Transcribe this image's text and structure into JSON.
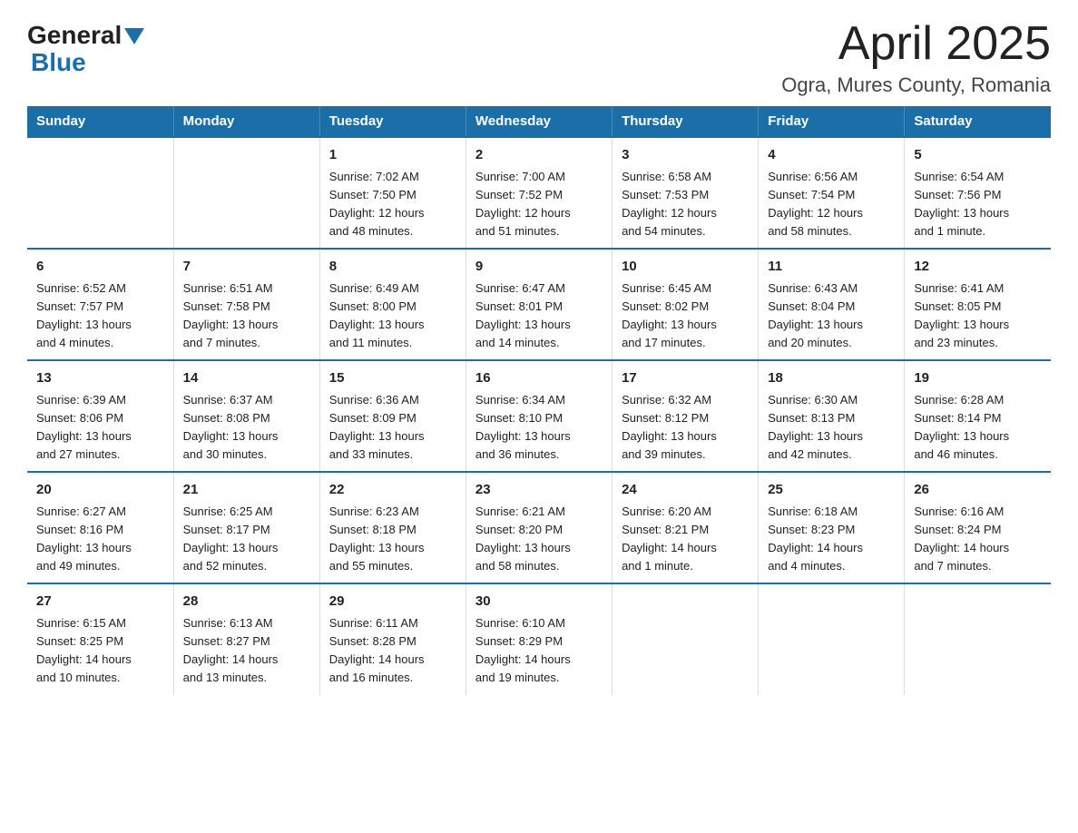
{
  "logo": {
    "general": "General",
    "blue": "Blue"
  },
  "header": {
    "month_year": "April 2025",
    "location": "Ogra, Mures County, Romania"
  },
  "days_of_week": [
    "Sunday",
    "Monday",
    "Tuesday",
    "Wednesday",
    "Thursday",
    "Friday",
    "Saturday"
  ],
  "weeks": [
    [
      {
        "day": "",
        "info": ""
      },
      {
        "day": "",
        "info": ""
      },
      {
        "day": "1",
        "info": "Sunrise: 7:02 AM\nSunset: 7:50 PM\nDaylight: 12 hours\nand 48 minutes."
      },
      {
        "day": "2",
        "info": "Sunrise: 7:00 AM\nSunset: 7:52 PM\nDaylight: 12 hours\nand 51 minutes."
      },
      {
        "day": "3",
        "info": "Sunrise: 6:58 AM\nSunset: 7:53 PM\nDaylight: 12 hours\nand 54 minutes."
      },
      {
        "day": "4",
        "info": "Sunrise: 6:56 AM\nSunset: 7:54 PM\nDaylight: 12 hours\nand 58 minutes."
      },
      {
        "day": "5",
        "info": "Sunrise: 6:54 AM\nSunset: 7:56 PM\nDaylight: 13 hours\nand 1 minute."
      }
    ],
    [
      {
        "day": "6",
        "info": "Sunrise: 6:52 AM\nSunset: 7:57 PM\nDaylight: 13 hours\nand 4 minutes."
      },
      {
        "day": "7",
        "info": "Sunrise: 6:51 AM\nSunset: 7:58 PM\nDaylight: 13 hours\nand 7 minutes."
      },
      {
        "day": "8",
        "info": "Sunrise: 6:49 AM\nSunset: 8:00 PM\nDaylight: 13 hours\nand 11 minutes."
      },
      {
        "day": "9",
        "info": "Sunrise: 6:47 AM\nSunset: 8:01 PM\nDaylight: 13 hours\nand 14 minutes."
      },
      {
        "day": "10",
        "info": "Sunrise: 6:45 AM\nSunset: 8:02 PM\nDaylight: 13 hours\nand 17 minutes."
      },
      {
        "day": "11",
        "info": "Sunrise: 6:43 AM\nSunset: 8:04 PM\nDaylight: 13 hours\nand 20 minutes."
      },
      {
        "day": "12",
        "info": "Sunrise: 6:41 AM\nSunset: 8:05 PM\nDaylight: 13 hours\nand 23 minutes."
      }
    ],
    [
      {
        "day": "13",
        "info": "Sunrise: 6:39 AM\nSunset: 8:06 PM\nDaylight: 13 hours\nand 27 minutes."
      },
      {
        "day": "14",
        "info": "Sunrise: 6:37 AM\nSunset: 8:08 PM\nDaylight: 13 hours\nand 30 minutes."
      },
      {
        "day": "15",
        "info": "Sunrise: 6:36 AM\nSunset: 8:09 PM\nDaylight: 13 hours\nand 33 minutes."
      },
      {
        "day": "16",
        "info": "Sunrise: 6:34 AM\nSunset: 8:10 PM\nDaylight: 13 hours\nand 36 minutes."
      },
      {
        "day": "17",
        "info": "Sunrise: 6:32 AM\nSunset: 8:12 PM\nDaylight: 13 hours\nand 39 minutes."
      },
      {
        "day": "18",
        "info": "Sunrise: 6:30 AM\nSunset: 8:13 PM\nDaylight: 13 hours\nand 42 minutes."
      },
      {
        "day": "19",
        "info": "Sunrise: 6:28 AM\nSunset: 8:14 PM\nDaylight: 13 hours\nand 46 minutes."
      }
    ],
    [
      {
        "day": "20",
        "info": "Sunrise: 6:27 AM\nSunset: 8:16 PM\nDaylight: 13 hours\nand 49 minutes."
      },
      {
        "day": "21",
        "info": "Sunrise: 6:25 AM\nSunset: 8:17 PM\nDaylight: 13 hours\nand 52 minutes."
      },
      {
        "day": "22",
        "info": "Sunrise: 6:23 AM\nSunset: 8:18 PM\nDaylight: 13 hours\nand 55 minutes."
      },
      {
        "day": "23",
        "info": "Sunrise: 6:21 AM\nSunset: 8:20 PM\nDaylight: 13 hours\nand 58 minutes."
      },
      {
        "day": "24",
        "info": "Sunrise: 6:20 AM\nSunset: 8:21 PM\nDaylight: 14 hours\nand 1 minute."
      },
      {
        "day": "25",
        "info": "Sunrise: 6:18 AM\nSunset: 8:23 PM\nDaylight: 14 hours\nand 4 minutes."
      },
      {
        "day": "26",
        "info": "Sunrise: 6:16 AM\nSunset: 8:24 PM\nDaylight: 14 hours\nand 7 minutes."
      }
    ],
    [
      {
        "day": "27",
        "info": "Sunrise: 6:15 AM\nSunset: 8:25 PM\nDaylight: 14 hours\nand 10 minutes."
      },
      {
        "day": "28",
        "info": "Sunrise: 6:13 AM\nSunset: 8:27 PM\nDaylight: 14 hours\nand 13 minutes."
      },
      {
        "day": "29",
        "info": "Sunrise: 6:11 AM\nSunset: 8:28 PM\nDaylight: 14 hours\nand 16 minutes."
      },
      {
        "day": "30",
        "info": "Sunrise: 6:10 AM\nSunset: 8:29 PM\nDaylight: 14 hours\nand 19 minutes."
      },
      {
        "day": "",
        "info": ""
      },
      {
        "day": "",
        "info": ""
      },
      {
        "day": "",
        "info": ""
      }
    ]
  ]
}
